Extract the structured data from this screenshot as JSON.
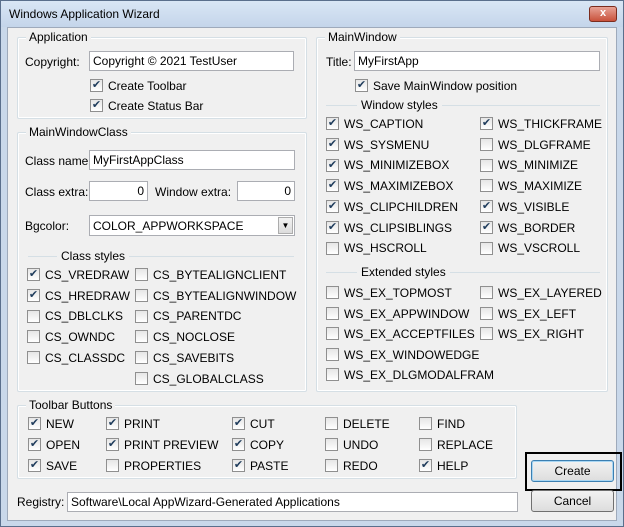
{
  "window": {
    "title": "Windows Application Wizard",
    "close_glyph": "x"
  },
  "application": {
    "title": "Application",
    "copyright_label": "Copyright:",
    "copyright_value": "Copyright © 2021 TestUser",
    "create_toolbar": {
      "label": "Create Toolbar",
      "checked": true
    },
    "create_statusbar": {
      "label": "Create Status Bar",
      "checked": true
    }
  },
  "mainwindowclass": {
    "title": "MainWindowClass",
    "classname_label": "Class name:",
    "classname_value": "MyFirstAppClass",
    "classextra_label": "Class extra:",
    "classextra_value": "0",
    "windowextra_label": "Window extra:",
    "windowextra_value": "0",
    "bgcolor_label": "Bgcolor:",
    "bgcolor_value": "COLOR_APPWORKSPACE",
    "classstyles_title": "Class styles",
    "styles_left": [
      {
        "label": "CS_VREDRAW",
        "checked": true
      },
      {
        "label": "CS_HREDRAW",
        "checked": true
      },
      {
        "label": "CS_DBLCLKS",
        "checked": false
      },
      {
        "label": "CS_OWNDC",
        "checked": false
      },
      {
        "label": "CS_CLASSDC",
        "checked": false
      }
    ],
    "styles_right": [
      {
        "label": "CS_BYTEALIGNCLIENT",
        "checked": false
      },
      {
        "label": "CS_BYTEALIGNWINDOW",
        "checked": false
      },
      {
        "label": "CS_PARENTDC",
        "checked": false
      },
      {
        "label": "CS_NOCLOSE",
        "checked": false
      },
      {
        "label": "CS_SAVEBITS",
        "checked": false
      },
      {
        "label": "CS_GLOBALCLASS",
        "checked": false
      }
    ]
  },
  "mainwindow": {
    "title": "MainWindow",
    "title_label": "Title:",
    "title_value": "MyFirstApp",
    "save_position": {
      "label": "Save MainWindow position",
      "checked": true
    },
    "window_styles_title": "Window styles",
    "ws_left": [
      {
        "label": "WS_CAPTION",
        "checked": true
      },
      {
        "label": "WS_SYSMENU",
        "checked": true
      },
      {
        "label": "WS_MINIMIZEBOX",
        "checked": true
      },
      {
        "label": "WS_MAXIMIZEBOX",
        "checked": true
      },
      {
        "label": "WS_CLIPCHILDREN",
        "checked": true
      },
      {
        "label": "WS_CLIPSIBLINGS",
        "checked": true
      },
      {
        "label": "WS_HSCROLL",
        "checked": false
      }
    ],
    "ws_right": [
      {
        "label": "WS_THICKFRAME",
        "checked": true
      },
      {
        "label": "WS_DLGFRAME",
        "checked": false
      },
      {
        "label": "WS_MINIMIZE",
        "checked": false
      },
      {
        "label": "WS_MAXIMIZE",
        "checked": false
      },
      {
        "label": "WS_VISIBLE",
        "checked": true
      },
      {
        "label": "WS_BORDER",
        "checked": true
      },
      {
        "label": "WS_VSCROLL",
        "checked": false
      }
    ],
    "extended_styles_title": "Extended styles",
    "ex_left": [
      {
        "label": "WS_EX_TOPMOST",
        "checked": false
      },
      {
        "label": "WS_EX_APPWINDOW",
        "checked": false
      },
      {
        "label": "WS_EX_ACCEPTFILES",
        "checked": false
      },
      {
        "label": "WS_EX_WINDOWEDGE",
        "checked": false
      },
      {
        "label": "WS_EX_DLGMODALFRAM",
        "checked": false
      }
    ],
    "ex_right": [
      {
        "label": "WS_EX_LAYERED",
        "checked": false
      },
      {
        "label": "WS_EX_LEFT",
        "checked": false
      },
      {
        "label": "WS_EX_RIGHT",
        "checked": false
      }
    ]
  },
  "toolbar_buttons": {
    "title": "Toolbar Buttons",
    "columns": [
      [
        {
          "label": "NEW",
          "checked": true
        },
        {
          "label": "OPEN",
          "checked": true
        },
        {
          "label": "SAVE",
          "checked": true
        }
      ],
      [
        {
          "label": "PRINT",
          "checked": true
        },
        {
          "label": "PRINT PREVIEW",
          "checked": true
        },
        {
          "label": "PROPERTIES",
          "checked": false
        }
      ],
      [
        {
          "label": "CUT",
          "checked": true
        },
        {
          "label": "COPY",
          "checked": true
        },
        {
          "label": "PASTE",
          "checked": true
        }
      ],
      [
        {
          "label": "DELETE",
          "checked": false
        },
        {
          "label": "UNDO",
          "checked": false
        },
        {
          "label": "REDO",
          "checked": false
        }
      ],
      [
        {
          "label": "FIND",
          "checked": false
        },
        {
          "label": "REPLACE",
          "checked": false
        },
        {
          "label": "HELP",
          "checked": true
        }
      ]
    ]
  },
  "registry": {
    "label": "Registry:",
    "value": "Software\\Local AppWizard-Generated Applications"
  },
  "buttons": {
    "create": "Create",
    "cancel": "Cancel"
  },
  "check_glyph": "✔"
}
